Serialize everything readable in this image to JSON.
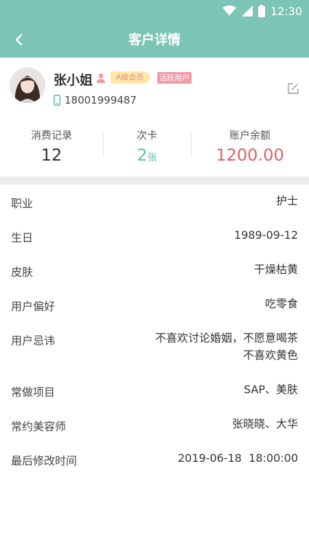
{
  "status_bar": {
    "time": "12:30",
    "icons": [
      "wifi-icon",
      "signal-icon",
      "battery-icon"
    ]
  },
  "app_bar": {
    "title": "客户详情",
    "back_icon": "chevron-left-icon"
  },
  "profile": {
    "name": "张小姐",
    "gender_icon": "person-icon",
    "member_badge": "A级会员",
    "status_badge": "活跃用户",
    "phone": "18001999487",
    "phone_icon": "mobile-phone-icon",
    "edit_icon": "edit-icon"
  },
  "stats": [
    {
      "label": "消费记录",
      "value": "12"
    },
    {
      "label": "次卡",
      "value": "2",
      "unit": "张"
    },
    {
      "label": "账户余额",
      "value": "1200.00"
    }
  ],
  "details": [
    {
      "label": "职业",
      "value": "护士"
    },
    {
      "label": "生日",
      "value": "1989-09-12"
    },
    {
      "label": "皮肤",
      "value": "干燥枯黄"
    },
    {
      "label": "用户偏好",
      "value": "吃零食"
    },
    {
      "label": "用户忌讳",
      "value_line1": "不喜欢讨论婚姻，不愿意喝茶",
      "value_line2": "不喜欢黄色"
    },
    {
      "label": "常做项目",
      "value": "SAP、美肤"
    },
    {
      "label": "常约美容师",
      "value": "张晓晓、大华"
    },
    {
      "label": "最后修改时间",
      "value": "2019-06-18  18:00:00"
    }
  ],
  "colors": {
    "primary": "#7cc5b6",
    "accent_teal": "#66bcaa",
    "balance_red": "#e06163",
    "member_badge_bg": "#fde9a6",
    "status_badge_bg": "#f19aa6"
  }
}
